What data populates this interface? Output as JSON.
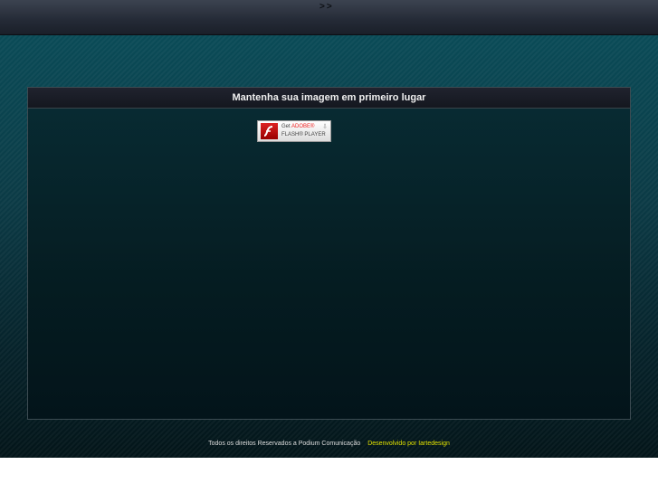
{
  "topbar": {
    "nav_label": ">>"
  },
  "panel": {
    "title": "Mantenha sua imagem em primeiro lugar",
    "flash_badge": {
      "line1_prefix": "Get",
      "line1_brand": "ADOBE®",
      "line2": "FLASH® PLAYER",
      "icon": "flash-icon"
    }
  },
  "footer": {
    "copyright": "Todos os direitos Reservados a Podium Comunicação",
    "developer": "Desenvolvido por Iartedesign"
  },
  "colors": {
    "developer_link": "#e0e000"
  }
}
